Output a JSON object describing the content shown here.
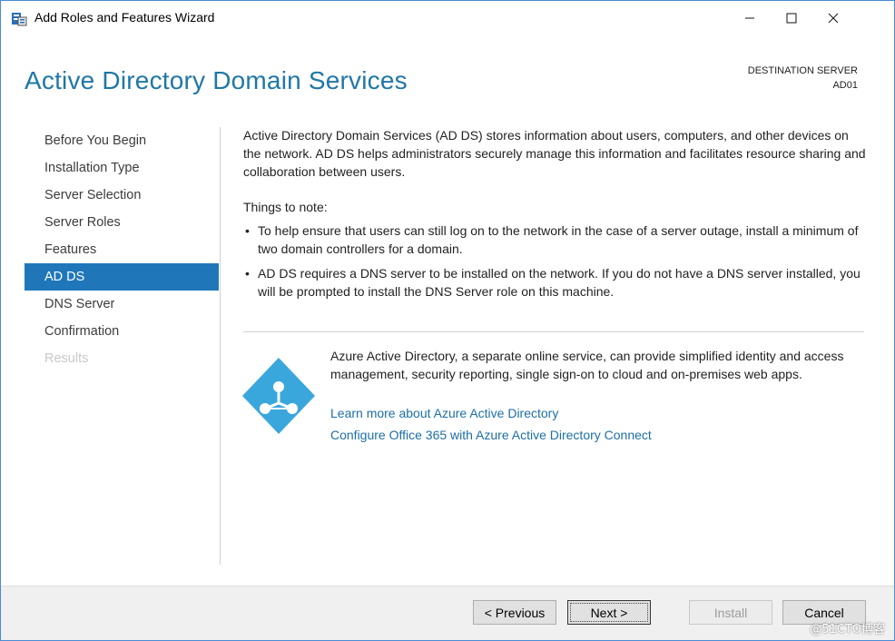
{
  "window": {
    "title": "Add Roles and Features Wizard"
  },
  "header": {
    "page_title": "Active Directory Domain Services",
    "destination_label": "DESTINATION SERVER",
    "destination_name": "AD01"
  },
  "nav": {
    "items": [
      {
        "label": "Before You Begin",
        "state": "normal"
      },
      {
        "label": "Installation Type",
        "state": "normal"
      },
      {
        "label": "Server Selection",
        "state": "normal"
      },
      {
        "label": "Server Roles",
        "state": "normal"
      },
      {
        "label": "Features",
        "state": "normal"
      },
      {
        "label": "AD DS",
        "state": "active"
      },
      {
        "label": "DNS Server",
        "state": "normal"
      },
      {
        "label": "Confirmation",
        "state": "normal"
      },
      {
        "label": "Results",
        "state": "disabled"
      }
    ]
  },
  "content": {
    "intro": "Active Directory Domain Services (AD DS) stores information about users, computers, and other devices on the network.  AD DS helps administrators securely manage this information and facilitates resource sharing and collaboration between users.",
    "notes_title": "Things to note:",
    "bullets": [
      "To help ensure that users can still log on to the network in the case of a server outage, install a minimum of two domain controllers for a domain.",
      "AD DS requires a DNS server to be installed on the network.  If you do not have a DNS server installed, you will be prompted to install the DNS Server role on this machine."
    ],
    "azure_text": "Azure Active Directory, a separate online service, can provide simplified identity and access management, security reporting, single sign-on to cloud and on-premises web apps.",
    "azure_links": [
      "Learn more about Azure Active Directory",
      "Configure Office 365 with Azure Active Directory Connect"
    ]
  },
  "footer": {
    "previous": "< Previous",
    "next": "Next >",
    "install": "Install",
    "cancel": "Cancel"
  },
  "watermark": "@51CTO博客",
  "colors": {
    "accent": "#1f77b9",
    "title": "#1f77a6",
    "link": "#1d6fa5",
    "azure_icon": "#3aa7dc"
  },
  "icons": {
    "app": "server-manager-icon",
    "azure": "azure-active-directory-icon"
  }
}
